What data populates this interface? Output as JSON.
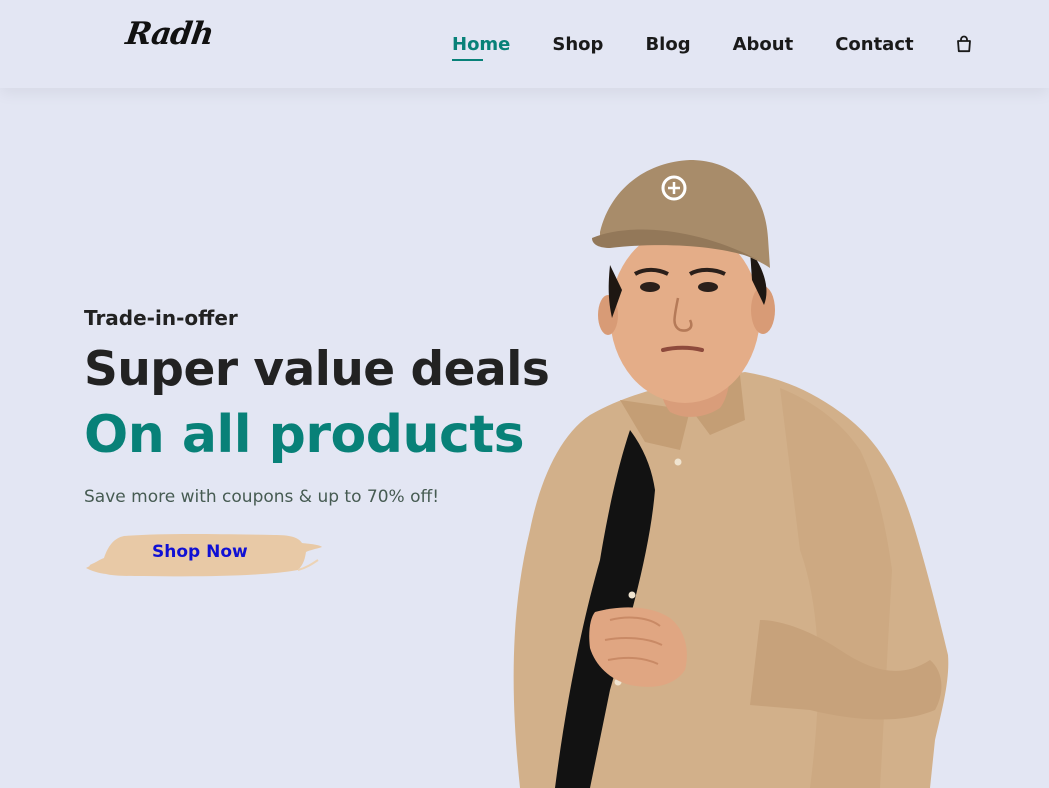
{
  "header": {
    "logo_text": "Radh",
    "nav": [
      {
        "label": "Home",
        "active": true
      },
      {
        "label": "Shop",
        "active": false
      },
      {
        "label": "Blog",
        "active": false
      },
      {
        "label": "About",
        "active": false
      },
      {
        "label": "Contact",
        "active": false
      }
    ],
    "cart_icon": "shopping-bag-icon"
  },
  "hero": {
    "kicker": "Trade-in-offer",
    "headline": "Super value deals",
    "headline_accent": "On all products",
    "subtext": "Save more with coupons & up to 70% off!",
    "cta_label": "Shop Now"
  },
  "colors": {
    "background": "#e3e6f3",
    "accent": "#088178",
    "text_dark": "#222222",
    "cta_text": "#1010d4",
    "cta_brush": "#e8c9a6"
  }
}
